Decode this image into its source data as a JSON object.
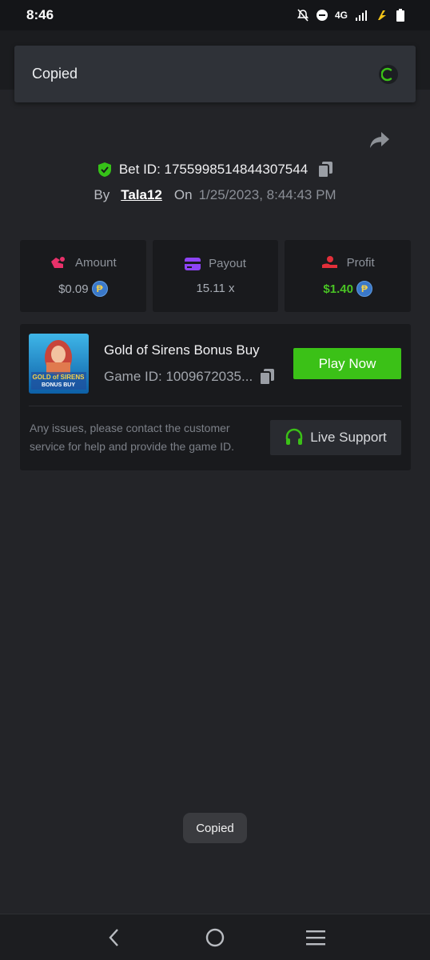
{
  "status_bar": {
    "time": "8:46",
    "network": "4G"
  },
  "top_toast": {
    "text": "Copied"
  },
  "bet": {
    "label": "Bet ID: 1755998514844307544"
  },
  "meta": {
    "by_label": "By",
    "username": "Tala12",
    "on_label": "On",
    "date": "1/25/2023, 8:44:43 PM"
  },
  "stats": {
    "amount": {
      "label": "Amount",
      "value": "$0.09"
    },
    "payout": {
      "label": "Payout",
      "value": "15.11 x"
    },
    "profit": {
      "label": "Profit",
      "value": "$1.40"
    }
  },
  "game": {
    "title": "Gold of Sirens Bonus Buy",
    "id_text": "Game ID: 1009672035...",
    "thumb_text_1": "GOLD of SIRENS",
    "thumb_text_2": "BONUS BUY",
    "play_label": "Play Now",
    "issue_text": "Any issues, please contact the customer service for help and provide the game ID.",
    "support_label": "Live Support"
  },
  "bottom_toast": {
    "text": "Copied"
  },
  "colors": {
    "accent_green": "#3bc117",
    "profit_green": "#49c424",
    "coin_blue": "#3a78c9"
  },
  "icons": [
    "shield-check-icon",
    "copy-icon",
    "share-icon",
    "amount-icon",
    "payout-icon",
    "profit-icon",
    "headset-icon",
    "back-icon",
    "home-icon",
    "menu-icon"
  ]
}
